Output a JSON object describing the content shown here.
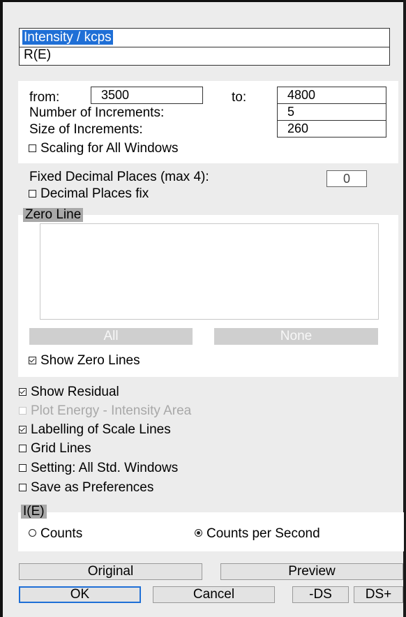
{
  "axis_selector": {
    "items": [
      {
        "label": "Intensity / kcps",
        "selected": true
      },
      {
        "label": "R(E)",
        "selected": false
      }
    ]
  },
  "range": {
    "from_label": "from:",
    "from_value": "3500",
    "to_label": "to:",
    "to_value": "4800",
    "increments_label": "Number of Increments:",
    "increments_value": "5",
    "size_label": "Size of Increments:",
    "size_value": "260",
    "scaling_all_label": "Scaling for All Windows",
    "scaling_all_checked": false
  },
  "decimals": {
    "fixed_label": "Fixed Decimal Places (max 4):",
    "fixed_value": "0",
    "fix_label": "Decimal Places fix",
    "fix_checked": false
  },
  "zero_line": {
    "title": "Zero Line",
    "all_label": "All",
    "none_label": "None",
    "show_label": "Show Zero Lines",
    "show_checked": true
  },
  "options": [
    {
      "label": "Show Residual",
      "checked": true,
      "enabled": true
    },
    {
      "label": "Plot Energy - Intensity Area",
      "checked": false,
      "enabled": false
    },
    {
      "label": "Labelling of Scale Lines",
      "checked": true,
      "enabled": true
    },
    {
      "label": "Grid Lines",
      "checked": false,
      "enabled": true
    },
    {
      "label": "Setting: All Std. Windows",
      "checked": false,
      "enabled": true
    },
    {
      "label": "Save as Preferences",
      "checked": false,
      "enabled": true
    }
  ],
  "ie_group": {
    "title": "I(E)",
    "counts_label": "Counts",
    "cps_label": "Counts per Second",
    "selected": "Counts per Second"
  },
  "buttons": {
    "original": "Original",
    "preview": "Preview",
    "ok": "OK",
    "cancel": "Cancel",
    "minus_ds": "-DS",
    "plus_ds": "DS+"
  },
  "colors": {
    "selection": "#1f6fd6",
    "background": "#ececec"
  }
}
